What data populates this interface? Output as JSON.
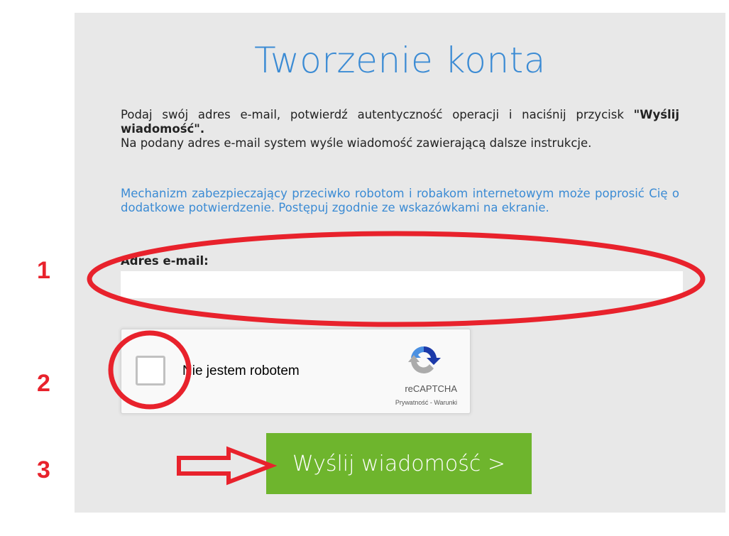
{
  "page": {
    "title": "Tworzenie konta",
    "intro_text_1": "Podaj swój adres e-mail, potwierdź autentyczność operacji i naciśnij przycisk ",
    "intro_bold": "\"Wyślij wiadomość\".",
    "intro_text_2": "Na podany adres e-mail system wyśle wiadomość zawierającą dalsze instrukcje.",
    "security_note": "Mechanizm zabezpieczający przeciwko robotom i robakom internetowym może poprosić Cię o dodatkowe potwierdzenie. Postępuj zgodnie ze wskazówkami na ekranie."
  },
  "form": {
    "email_label": "Adres e-mail:",
    "email_value": "",
    "submit_label": "Wyślij wiadomość >"
  },
  "captcha": {
    "label": "Nie jestem robotem",
    "brand": "reCAPTCHA",
    "links": "Prywatność - Warunki"
  },
  "annotations": {
    "step1": "1",
    "step2": "2",
    "step3": "3"
  },
  "colors": {
    "title_blue": "#3b8bd4",
    "button_green": "#6eb52d",
    "annotation_red": "#e8222c",
    "panel_bg": "#e8e8e8"
  }
}
